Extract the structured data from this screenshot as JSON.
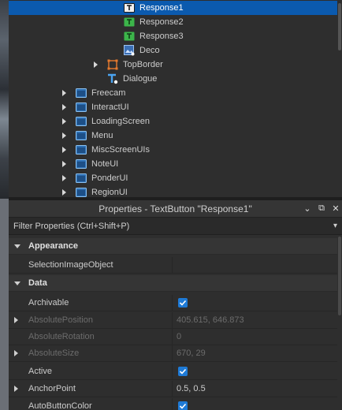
{
  "explorer": {
    "items": [
      {
        "label": "Response1",
        "icon": "textbutton-icon",
        "selected": true,
        "expandable": false
      },
      {
        "label": "Response2",
        "icon": "textbutton-green-icon",
        "selected": false,
        "expandable": false
      },
      {
        "label": "Response3",
        "icon": "textbutton-green-icon",
        "selected": false,
        "expandable": false
      },
      {
        "label": "Deco",
        "icon": "imagelabel-icon",
        "selected": false,
        "expandable": false
      },
      {
        "label": "TopBorder",
        "icon": "frame-icon",
        "selected": false,
        "expandable": true
      },
      {
        "label": "Dialogue",
        "icon": "textlabel-icon",
        "selected": false,
        "expandable": false
      },
      {
        "label": "Freecam",
        "icon": "screengui-icon",
        "selected": false,
        "expandable": true
      },
      {
        "label": "InteractUI",
        "icon": "screengui-icon",
        "selected": false,
        "expandable": true
      },
      {
        "label": "LoadingScreen",
        "icon": "screengui-icon",
        "selected": false,
        "expandable": true
      },
      {
        "label": "Menu",
        "icon": "screengui-icon",
        "selected": false,
        "expandable": true
      },
      {
        "label": "MiscScreenUIs",
        "icon": "screengui-icon",
        "selected": false,
        "expandable": true
      },
      {
        "label": "NoteUI",
        "icon": "screengui-icon",
        "selected": false,
        "expandable": true
      },
      {
        "label": "PonderUI",
        "icon": "screengui-icon",
        "selected": false,
        "expandable": true
      },
      {
        "label": "RegionUI",
        "icon": "screengui-icon",
        "selected": false,
        "expandable": true
      }
    ]
  },
  "properties": {
    "title": "Properties - TextButton \"Response1\"",
    "filter_placeholder": "Filter Properties (Ctrl+Shift+P)",
    "categories": {
      "appearance": "Appearance",
      "data": "Data"
    },
    "rows": {
      "selection_image_object": {
        "name": "SelectionImageObject",
        "value": ""
      },
      "archivable": {
        "name": "Archivable",
        "checked": true
      },
      "absolute_position": {
        "name": "AbsolutePosition",
        "value": "405.615, 646.873"
      },
      "absolute_rotation": {
        "name": "AbsoluteRotation",
        "value": "0"
      },
      "absolute_size": {
        "name": "AbsoluteSize",
        "value": "670, 29"
      },
      "active": {
        "name": "Active",
        "checked": true
      },
      "anchor_point": {
        "name": "AnchorPoint",
        "value": "0.5, 0.5"
      },
      "auto_button_color": {
        "name": "AutoButtonColor",
        "checked": true
      }
    }
  },
  "colors": {
    "selection": "#0b5aae",
    "checkbox": "#1e7ad6",
    "panel_bg": "#2e2e2e",
    "disabled_text": "#6c6c6c"
  }
}
